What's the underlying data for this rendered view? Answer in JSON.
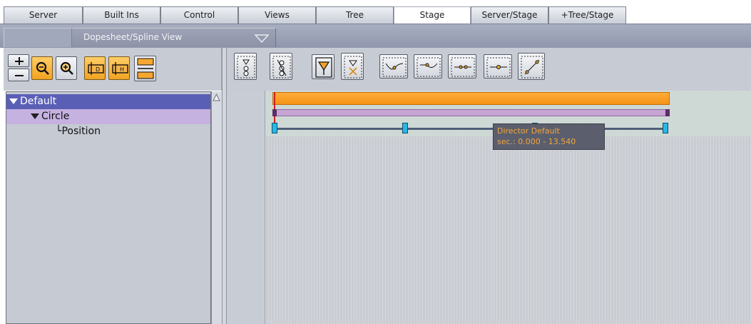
{
  "tabs": [
    {
      "label": "Server",
      "active": false
    },
    {
      "label": "Built Ins",
      "active": false
    },
    {
      "label": "Control",
      "active": false
    },
    {
      "label": "Views",
      "active": false
    },
    {
      "label": "Tree",
      "active": false
    },
    {
      "label": "Stage",
      "active": true
    },
    {
      "label": "Server/Stage",
      "active": false
    },
    {
      "label": "+Tree/Stage",
      "active": false
    }
  ],
  "view_selector": {
    "label": "Dopesheet/Spline View"
  },
  "left_toolbar": {
    "buttons": [
      "zoom-in-out-buttons",
      "zoom-out-icon",
      "zoom-in-icon",
      "dopesheet-d-icon",
      "dopesheet-h-icon",
      "split-layout-icon"
    ]
  },
  "right_toolbar": {
    "buttons": [
      "add-keyframe-icon",
      "remove-keyframe-icon",
      "keyframe-marker-icon",
      "delete-keyframe-icon",
      "ease-in-icon",
      "ease-out-icon",
      "linear-icon",
      "constant-icon",
      "bezier-icon"
    ]
  },
  "tree": {
    "items": [
      {
        "label": "Default",
        "level": 0,
        "expanded": true,
        "selected": true
      },
      {
        "label": "Circle",
        "level": 1,
        "expanded": true
      },
      {
        "label": "Position",
        "level": 2,
        "prefix": "└"
      }
    ]
  },
  "timeline": {
    "tooltip_title": "Director Default",
    "tooltip_range": "sec.: 0.000 - 13.540",
    "colors": {
      "director_bar": "#f39316",
      "object_bar": "#c6a5d4",
      "keyframe": "#27b9e6"
    }
  }
}
